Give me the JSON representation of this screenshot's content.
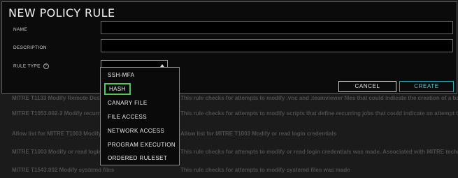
{
  "modal": {
    "title": "NEW POLICY RULE",
    "name_label": "NAME",
    "description_label": "DESCRIPTION",
    "rule_type_label": "RULE TYPE",
    "rule_type_value": "",
    "cancel_label": "CANCEL",
    "create_label": "CREATE"
  },
  "dropdown": {
    "options": [
      "SSH-MFA",
      "HASH",
      "CANARY FILE",
      "FILE ACCESS",
      "NETWORK ACCESS",
      "PROGRAM EXECUTION",
      "ORDERED RULESET"
    ],
    "selected": "HASH",
    "highlight_color": "#53c653"
  },
  "background_rows": [
    {
      "name": "MITRE T1133 Modify Remote Desk",
      "description": "This rule checks for attempts to modify .vnc and .teamviewer files that could indicate the creation of a back"
    },
    {
      "name": "MITRE T1053.002-3 Modify recurri",
      "description": "This rule checks for attempts to modify scripts that define recurring jobs that could indicate an attempt to"
    },
    {
      "name": "Allow list for MITRE T1003 Modify",
      "description": "Allow list for MITRE T1003 Modify or read login credentials"
    },
    {
      "name": "MITRE T1003 Modify or read login",
      "description": "This rule checks for attempts to modify or read login credentials was made. Associated with MITRE technique"
    },
    {
      "name": "MITRE T1543.002 Modify systemd files",
      "description": "This rule checks for attempts to modify systemd files was made"
    }
  ],
  "colors": {
    "accent": "#2fa8b5",
    "modal_bg": "#0b0b0b"
  }
}
